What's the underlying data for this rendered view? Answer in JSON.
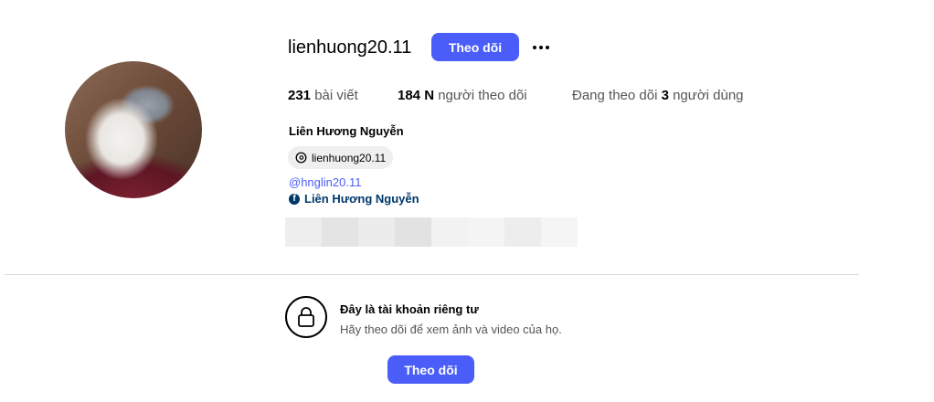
{
  "profile": {
    "username": "lienhuong20.11",
    "follow_label": "Theo dõi",
    "more_icon": "more-horizontal-icon",
    "avatar_icon": "profile-photo"
  },
  "stats": {
    "posts_count": "231",
    "posts_label": "bài viết",
    "followers_count": "184 N",
    "followers_label": "người theo dõi",
    "following_prefix": "Đang theo dõi",
    "following_count": "3",
    "following_label": "người dùng"
  },
  "bio": {
    "full_name": "Liên Hương Nguyễn",
    "threads_handle": "lienhuong20.11",
    "mention": "@hnglin20.11",
    "facebook_name": "Liên Hương Nguyễn"
  },
  "private": {
    "title": "Đây là tài khoản riêng tư",
    "subtitle": "Hãy theo dõi để xem ảnh và video của họ.",
    "follow_label": "Theo dõi",
    "icon": "lock-icon"
  },
  "colors": {
    "accent": "#4a5df9",
    "link": "#00376b",
    "divider": "#dbdbdb"
  }
}
